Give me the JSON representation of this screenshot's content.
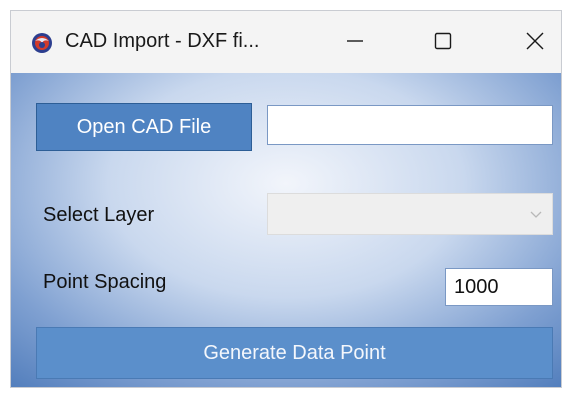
{
  "window": {
    "title": "CAD Import - DXF fi...",
    "icon": "cad-app-icon",
    "controls": {
      "minimize_icon": "minimize-icon",
      "maximize_icon": "maximize-icon",
      "close_icon": "close-icon"
    }
  },
  "form": {
    "open_button_label": "Open CAD File",
    "file_path_value": "",
    "select_layer_label": "Select Layer",
    "select_layer_value": "",
    "point_spacing_label": "Point Spacing",
    "point_spacing_value": "1000",
    "generate_button_label": "Generate Data Point"
  },
  "colors": {
    "accent_button": "#4f83c2",
    "generate_button": "#5b8fcb",
    "background_edge": "#3e6fb3",
    "background_center": "#f2f5fb"
  }
}
